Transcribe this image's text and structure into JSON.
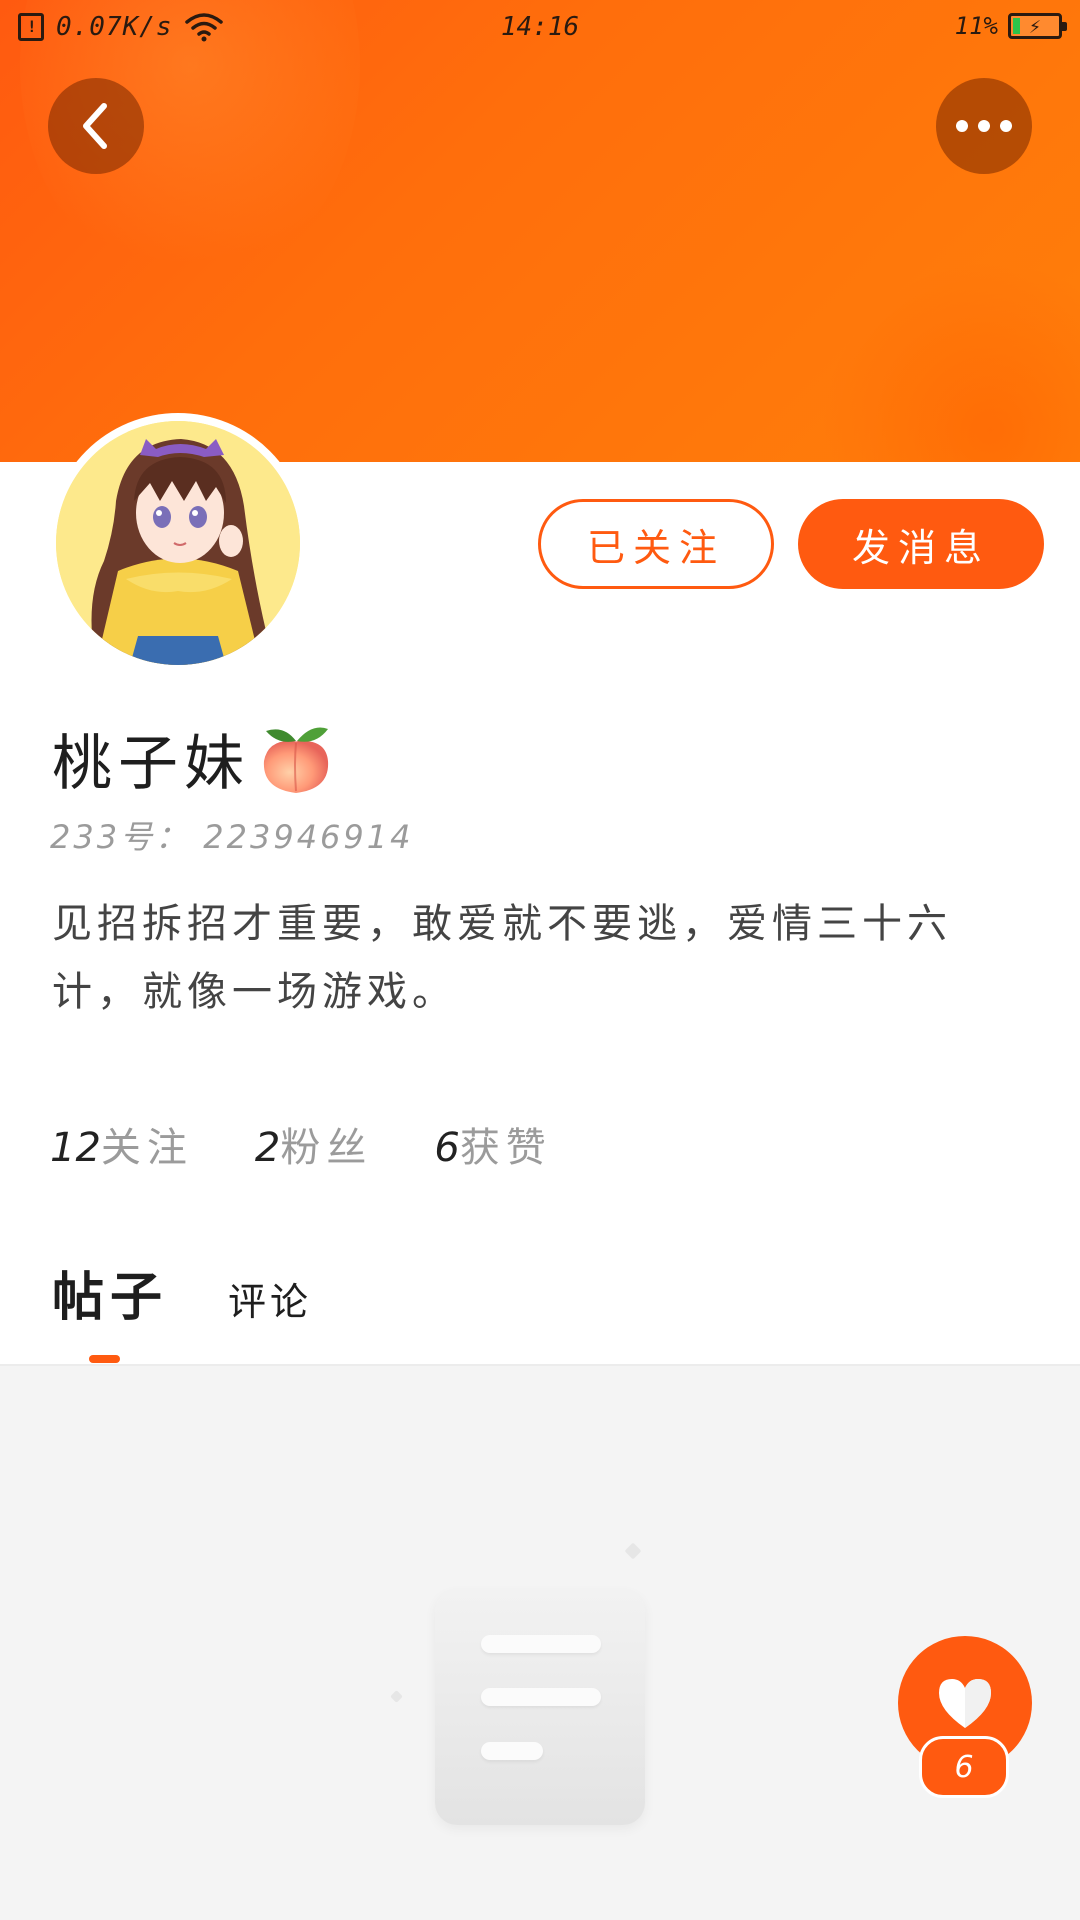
{
  "status_bar": {
    "speed": "0.07K/s",
    "time": "14:16",
    "battery": "11%"
  },
  "profile": {
    "name": "桃子妹",
    "uid": "233号： 223946914",
    "bio": "见招拆招才重要，敢爱就不要逃，爱情三十六计，就像一场游戏。",
    "stats": [
      {
        "num": "12",
        "label": "关注"
      },
      {
        "num": "2",
        "label": "粉丝"
      },
      {
        "num": "6",
        "label": "获赞"
      }
    ]
  },
  "actions": {
    "followed_label": "已关注",
    "message_label": "发消息"
  },
  "tabs": {
    "posts": "帖子",
    "comments": "评论"
  },
  "like": {
    "count": "6"
  },
  "colors": {
    "accent": "#ff5a10",
    "banner": "#ff6e0c"
  },
  "icons": [
    "back-icon",
    "more-icon",
    "peach-emoji-icon",
    "heart-icon",
    "empty-document-icon"
  ]
}
